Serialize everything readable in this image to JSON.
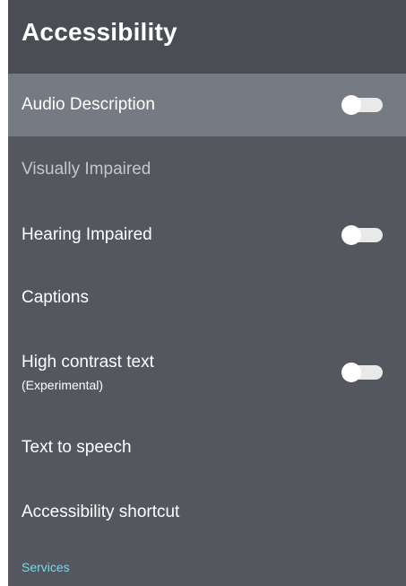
{
  "header": {
    "title": "Accessibility"
  },
  "items": [
    {
      "label": "Audio Description",
      "toggle": "off",
      "focused": true
    },
    {
      "label": "Visually Impaired"
    },
    {
      "label": "Hearing Impaired",
      "toggle": "off"
    },
    {
      "label": "Captions"
    },
    {
      "label": "High contrast text",
      "sublabel": "(Experimental)",
      "toggle": "off"
    },
    {
      "label": "Text to speech"
    },
    {
      "label": "Accessibility shortcut"
    }
  ],
  "section": {
    "label": "Services"
  },
  "colors": {
    "panel_bg": "#54575d",
    "header_bg": "#4a4d53",
    "focus_bg": "#767a82",
    "section_accent": "#7fd6ea"
  }
}
